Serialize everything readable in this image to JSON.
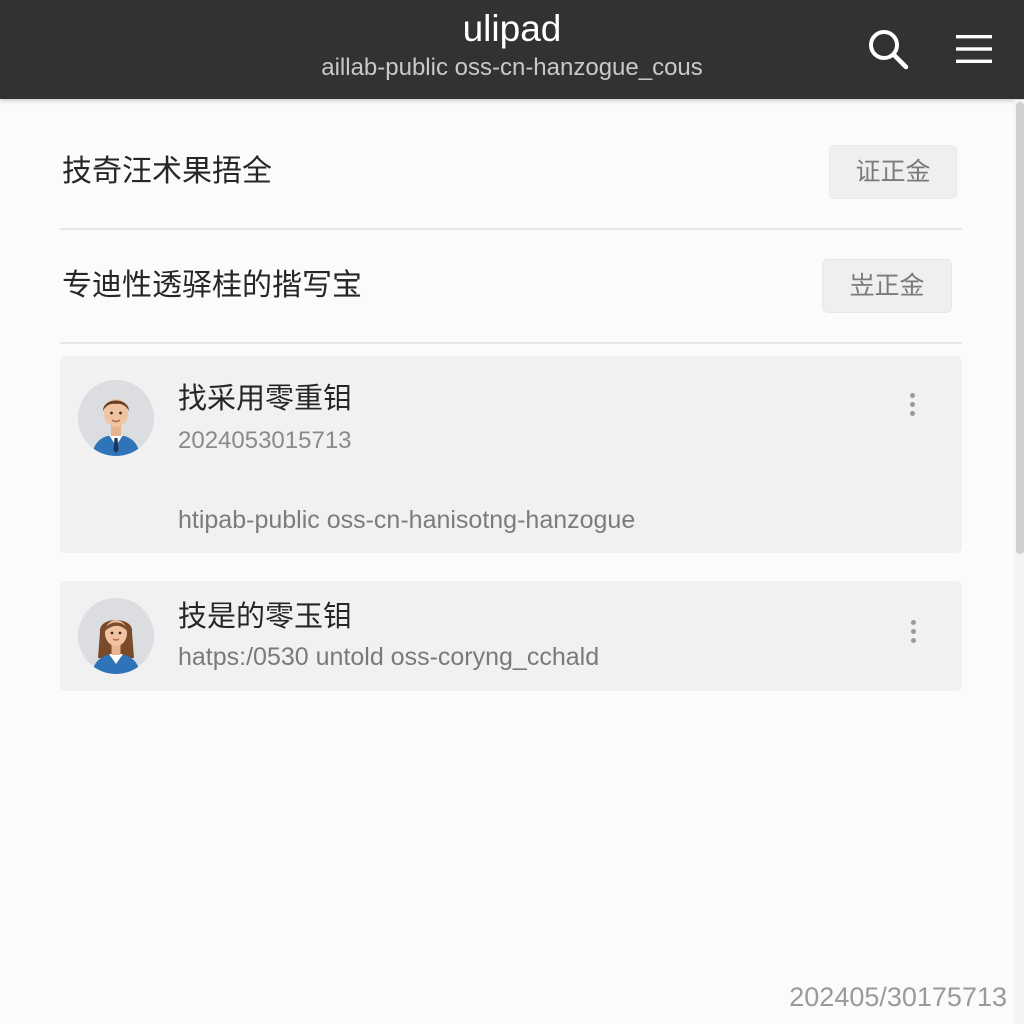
{
  "header": {
    "title": "ulipad",
    "subtitle": "aillab-public oss-cn-hanzogue_cous",
    "search_icon": "search-icon",
    "menu_icon": "hamburger-menu-icon",
    "background_color": "#313234"
  },
  "settings": [
    {
      "label": "技奇汪术果捂全",
      "button": "证正金"
    },
    {
      "label": "专迪性透驿桂的揩写宝",
      "button": "岦正金"
    }
  ],
  "cards": [
    {
      "avatar_icon": "male-avatar-icon",
      "title": "找采用零重钼",
      "meta": "2024053015713",
      "link": "htipab-public oss-cn-hanisotng-hanzogue",
      "more_icon": "more-vertical-icon"
    },
    {
      "avatar_icon": "female-avatar-icon",
      "title": "技是的零玉钼",
      "meta": "hatps:/0530 untold oss-coryng_cchald",
      "more_icon": "more-vertical-icon"
    }
  ],
  "footer": {
    "timestamp": "202405/30175713"
  }
}
